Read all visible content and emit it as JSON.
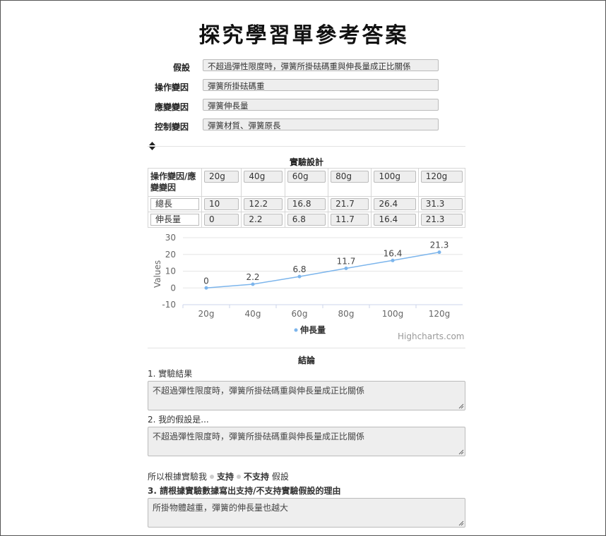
{
  "title": "探究學習單參考答案",
  "variables": [
    {
      "label": "假設",
      "value": "不超過彈性限度時，彈簧所掛砝碼重與伸長量成正比關係"
    },
    {
      "label": "操作變因",
      "value": "彈簧所掛砝碼重"
    },
    {
      "label": "應變變因",
      "value": "彈簧伸長量"
    },
    {
      "label": "控制變因",
      "value": "彈簧材質、彈簧原長"
    }
  ],
  "design": {
    "title": "實驗設計",
    "corner_label": "操作變因/應變變因",
    "columns": [
      "20g",
      "40g",
      "60g",
      "80g",
      "100g",
      "120g"
    ],
    "rows": [
      {
        "name": "總長",
        "values": [
          "10",
          "12.2",
          "16.8",
          "21.7",
          "26.4",
          "31.3"
        ]
      },
      {
        "name": "伸長量",
        "values": [
          "0",
          "2.2",
          "6.8",
          "11.7",
          "16.4",
          "21.3"
        ]
      }
    ]
  },
  "chart_data": {
    "type": "line",
    "categories": [
      "20g",
      "40g",
      "60g",
      "80g",
      "100g",
      "120g"
    ],
    "series": [
      {
        "name": "伸長量",
        "values": [
          0,
          2.2,
          6.8,
          11.7,
          16.4,
          21.3
        ],
        "color": "#7cb5ec"
      }
    ],
    "ylabel": "Values",
    "yticks": [
      30,
      20,
      10,
      0,
      -10
    ],
    "ylim": [
      -10,
      30
    ],
    "grid": true,
    "legend_placement": "bottom-center",
    "credits": "Highcharts.com"
  },
  "conclusion": {
    "title": "結論",
    "q1_label": "1. 實驗結果",
    "q1_value": "不超過彈性限度時，彈簧所掛砝碼重與伸長量成正比關係",
    "q2_label": "2. 我的假設是...",
    "q2_value": "不超過彈性限度時，彈簧所掛砝碼重與伸長量成正比關係",
    "support_prefix": "所以根據實驗我",
    "support_option": "支持",
    "not_support_option": "不支持",
    "support_suffix": "假設",
    "q3_label": "3. 請根據實驗數據寫出支持/不支持實驗假設的理由",
    "q3_value": "所掛物體越重，彈簧的伸長量也越大"
  }
}
